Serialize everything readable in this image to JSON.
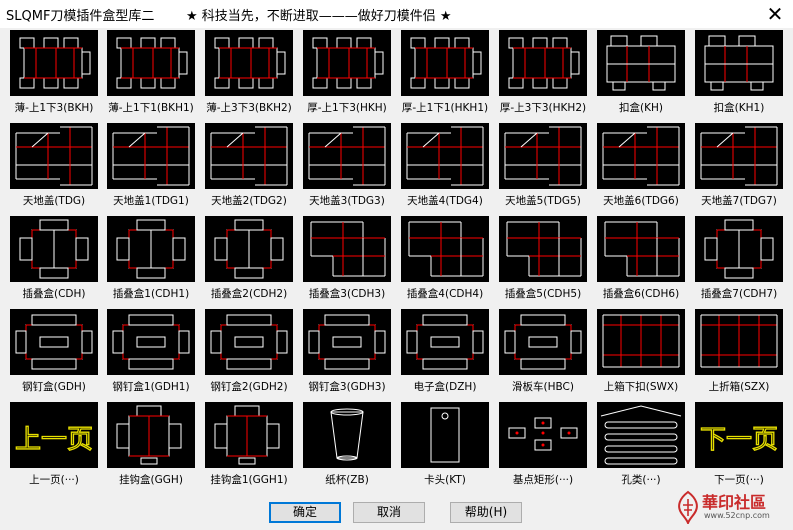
{
  "window": {
    "title": "SLQMF刀模插件盒型库二",
    "slogan": "★ 科技当先，不断进取———做好刀模件侣 ★"
  },
  "items": [
    {
      "label": "薄-上1下3(BKH)",
      "kind": "box2"
    },
    {
      "label": "薄-上1下1(BKH1)",
      "kind": "box2"
    },
    {
      "label": "薄-上3下3(BKH2)",
      "kind": "box2"
    },
    {
      "label": "厚-上1下3(HKH)",
      "kind": "box2"
    },
    {
      "label": "厚-上1下1(HKH1)",
      "kind": "box2"
    },
    {
      "label": "厚-上3下3(HKH2)",
      "kind": "box2"
    },
    {
      "label": "扣盒(KH)",
      "kind": "buckle"
    },
    {
      "label": "扣盒(KH1)",
      "kind": "buckle"
    },
    {
      "label": "天地盖(TDG)",
      "kind": "lid"
    },
    {
      "label": "天地盖1(TDG1)",
      "kind": "lid"
    },
    {
      "label": "天地盖2(TDG2)",
      "kind": "lid"
    },
    {
      "label": "天地盖3(TDG3)",
      "kind": "lid"
    },
    {
      "label": "天地盖4(TDG4)",
      "kind": "lid"
    },
    {
      "label": "天地盖5(TDG5)",
      "kind": "lid"
    },
    {
      "label": "天地盖6(TDG6)",
      "kind": "lid"
    },
    {
      "label": "天地盖7(TDG7)",
      "kind": "lid"
    },
    {
      "label": "插叠盒(CDH)",
      "kind": "cross"
    },
    {
      "label": "插叠盒1(CDH1)",
      "kind": "cross"
    },
    {
      "label": "插叠盒2(CDH2)",
      "kind": "cross"
    },
    {
      "label": "插叠盒3(CDH3)",
      "kind": "step"
    },
    {
      "label": "插叠盒4(CDH4)",
      "kind": "step"
    },
    {
      "label": "插叠盒5(CDH5)",
      "kind": "step"
    },
    {
      "label": "插叠盒6(CDH6)",
      "kind": "step"
    },
    {
      "label": "插叠盒7(CDH7)",
      "kind": "cross"
    },
    {
      "label": "钢钉盒(GDH)",
      "kind": "tray"
    },
    {
      "label": "钢钉盒1(GDH1)",
      "kind": "tray"
    },
    {
      "label": "钢钉盒2(GDH2)",
      "kind": "tray"
    },
    {
      "label": "钢钉盒3(GDH3)",
      "kind": "tray"
    },
    {
      "label": "电子盒(DZH)",
      "kind": "tray"
    },
    {
      "label": "滑板车(HBC)",
      "kind": "tray"
    },
    {
      "label": "上箱下扣(SWX)",
      "kind": "carton"
    },
    {
      "label": "上折箱(SZX)",
      "kind": "carton"
    },
    {
      "label": "上一页(···)",
      "kind": "prev",
      "glyph": "上一页"
    },
    {
      "label": "挂钩盒(GGH)",
      "kind": "hook"
    },
    {
      "label": "挂钩盒1(GGH1)",
      "kind": "hook"
    },
    {
      "label": "纸杯(ZB)",
      "kind": "cup"
    },
    {
      "label": "卡头(KT)",
      "kind": "card"
    },
    {
      "label": "基点矩形(···)",
      "kind": "points"
    },
    {
      "label": "孔类(···)",
      "kind": "holes"
    },
    {
      "label": "下一页(···)",
      "kind": "next",
      "glyph": "下一页"
    }
  ],
  "buttons": {
    "ok": "确定",
    "cancel": "取消",
    "help": "帮助(H)"
  },
  "watermark": {
    "text": "華印社區",
    "url": "www.52cnp.com"
  },
  "colors": {
    "line": "#ffffff",
    "fold": "#ff0000",
    "thumb_bg": "#000000",
    "glyph": "#e8e000"
  }
}
